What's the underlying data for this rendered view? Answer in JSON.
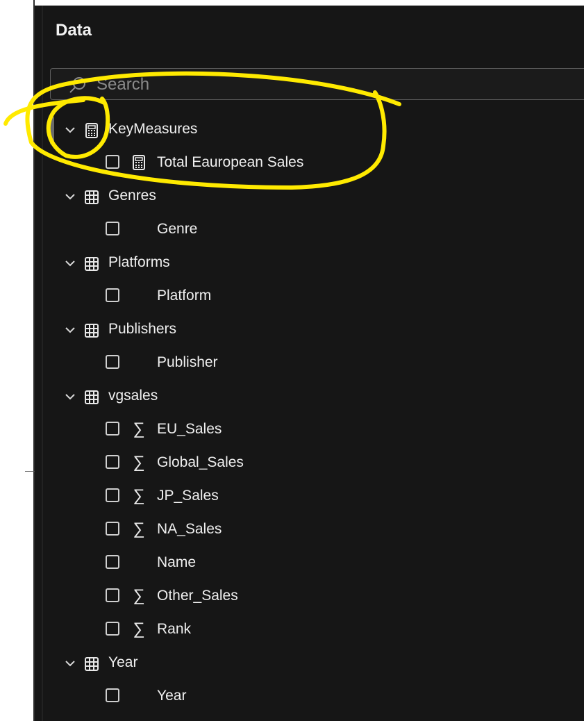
{
  "panel": {
    "title": "Data"
  },
  "search": {
    "placeholder": "Search",
    "value": ""
  },
  "tree": {
    "groups": [
      {
        "label": "KeyMeasures",
        "icon": "calculator-icon",
        "expanded": true,
        "fields": [
          {
            "label": "Total Eauropean Sales",
            "icon": "calculator-icon"
          }
        ]
      },
      {
        "label": "Genres",
        "icon": "table-icon",
        "expanded": true,
        "fields": [
          {
            "label": "Genre",
            "icon": ""
          }
        ]
      },
      {
        "label": "Platforms",
        "icon": "table-icon",
        "expanded": true,
        "fields": [
          {
            "label": "Platform",
            "icon": ""
          }
        ]
      },
      {
        "label": "Publishers",
        "icon": "table-icon",
        "expanded": true,
        "fields": [
          {
            "label": "Publisher",
            "icon": ""
          }
        ]
      },
      {
        "label": "vgsales",
        "icon": "table-icon",
        "expanded": true,
        "fields": [
          {
            "label": "EU_Sales",
            "icon": "sigma-icon"
          },
          {
            "label": "Global_Sales",
            "icon": "sigma-icon"
          },
          {
            "label": "JP_Sales",
            "icon": "sigma-icon"
          },
          {
            "label": "NA_Sales",
            "icon": "sigma-icon"
          },
          {
            "label": "Name",
            "icon": ""
          },
          {
            "label": "Other_Sales",
            "icon": "sigma-icon"
          },
          {
            "label": "Rank",
            "icon": "sigma-icon"
          }
        ]
      },
      {
        "label": "Year",
        "icon": "table-icon",
        "expanded": true,
        "fields": [
          {
            "label": "Year",
            "icon": ""
          }
        ]
      }
    ]
  },
  "colors": {
    "panel_bg": "#161616",
    "text": "#efefef",
    "annotation": "#ffea00"
  }
}
